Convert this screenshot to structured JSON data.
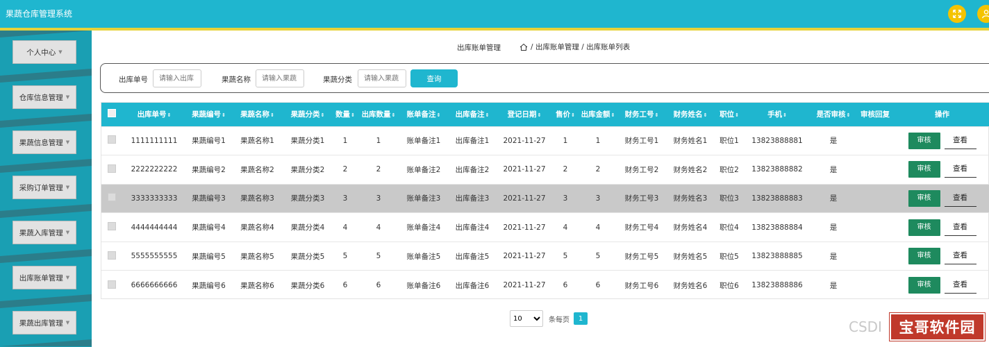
{
  "app": {
    "title": "果蔬仓库管理系统",
    "accent_color": "#1fb6cf",
    "stripe_color": "#e7d23a",
    "top_icons": [
      "fullscreen-icon",
      "user-icon"
    ]
  },
  "sidebar": {
    "items": [
      {
        "label": "个人中心"
      },
      {
        "label": "仓库信息管理"
      },
      {
        "label": "果蔬信息管理"
      },
      {
        "label": "采购订单管理"
      },
      {
        "label": "果蔬入库管理"
      },
      {
        "label": "出库账单管理"
      },
      {
        "label": "果蔬出库管理"
      }
    ]
  },
  "breadcrumb": {
    "page_title": "出库账单管理",
    "path": "/ 出库账单管理 / 出库账单列表"
  },
  "search": {
    "fields": [
      {
        "label": "出库单号",
        "placeholder": "请输入出库"
      },
      {
        "label": "果蔬名称",
        "placeholder": "请输入果蔬"
      },
      {
        "label": "果蔬分类",
        "placeholder": "请输入果蔬"
      }
    ],
    "button": "查询"
  },
  "table": {
    "columns": [
      "出库单号",
      "果蔬编号",
      "果蔬名称",
      "果蔬分类",
      "数量",
      "出库数量",
      "账单备注",
      "出库备注",
      "登记日期",
      "售价",
      "出库金额",
      "财务工号",
      "财务姓名",
      "职位",
      "手机",
      "是否审核",
      "审核回复",
      "操作"
    ],
    "audit_label": "审核",
    "view_label": "查看",
    "rows": [
      [
        "1111111111",
        "果蔬编号1",
        "果蔬名称1",
        "果蔬分类1",
        "1",
        "1",
        "账单备注1",
        "出库备注1",
        "2021-11-27",
        "1",
        "1",
        "财务工号1",
        "财务姓名1",
        "职位1",
        "13823888881",
        "是",
        ""
      ],
      [
        "2222222222",
        "果蔬编号2",
        "果蔬名称2",
        "果蔬分类2",
        "2",
        "2",
        "账单备注2",
        "出库备注2",
        "2021-11-27",
        "2",
        "2",
        "财务工号2",
        "财务姓名2",
        "职位2",
        "13823888882",
        "是",
        ""
      ],
      [
        "3333333333",
        "果蔬编号3",
        "果蔬名称3",
        "果蔬分类3",
        "3",
        "3",
        "账单备注3",
        "出库备注3",
        "2021-11-27",
        "3",
        "3",
        "财务工号3",
        "财务姓名3",
        "职位3",
        "13823888883",
        "是",
        ""
      ],
      [
        "4444444444",
        "果蔬编号4",
        "果蔬名称4",
        "果蔬分类4",
        "4",
        "4",
        "账单备注4",
        "出库备注4",
        "2021-11-27",
        "4",
        "4",
        "财务工号4",
        "财务姓名4",
        "职位4",
        "13823888884",
        "是",
        ""
      ],
      [
        "5555555555",
        "果蔬编号5",
        "果蔬名称5",
        "果蔬分类5",
        "5",
        "5",
        "账单备注5",
        "出库备注5",
        "2021-11-27",
        "5",
        "5",
        "财务工号5",
        "财务姓名5",
        "职位5",
        "13823888885",
        "是",
        ""
      ],
      [
        "6666666666",
        "果蔬编号6",
        "果蔬名称6",
        "果蔬分类6",
        "6",
        "6",
        "账单备注6",
        "出库备注6",
        "2021-11-27",
        "6",
        "6",
        "财务工号6",
        "财务姓名6",
        "职位6",
        "13823888886",
        "是",
        ""
      ]
    ],
    "highlighted_row": 3
  },
  "pagination": {
    "page_size": "10",
    "page_size_suffix": "条每页",
    "current_page": "1"
  },
  "watermark": {
    "csdn": "CSDI",
    "badge": "宝哥软件园"
  }
}
